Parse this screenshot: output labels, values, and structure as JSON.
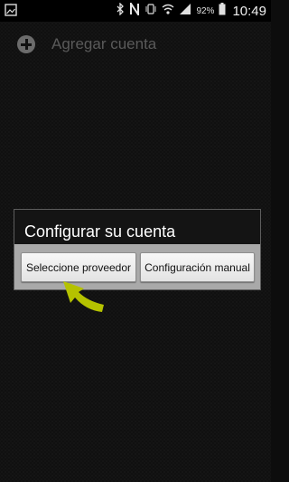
{
  "status_bar": {
    "battery_pct": "92%",
    "time": "10:49",
    "icons": [
      "image-icon",
      "bluetooth-icon",
      "nfc-icon",
      "vibrate-icon",
      "wifi-icon",
      "signal-icon",
      "battery-icon"
    ]
  },
  "action": {
    "label": "Agregar cuenta",
    "icon": "add-circle-icon"
  },
  "dialog": {
    "title": "Configurar su cuenta",
    "buttons": {
      "provider": "Seleccione proveedor",
      "manual": "Configuración manual"
    }
  },
  "annotation": {
    "arrow_color": "#b5c200"
  }
}
